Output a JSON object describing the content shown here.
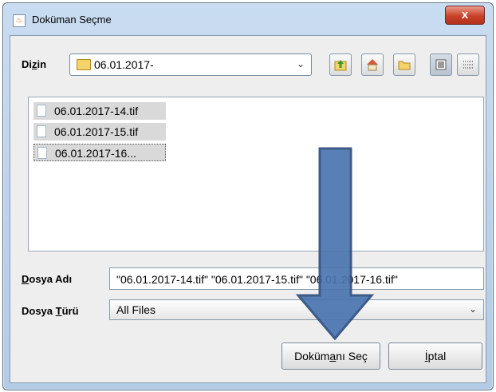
{
  "window": {
    "title": "Doküman Seçme",
    "close_glyph": "x"
  },
  "directory": {
    "label_pre": "Di",
    "label_mnemonic": "z",
    "label_post": "in",
    "value": "06.01.2017-"
  },
  "toolbar": {
    "icons": [
      "up-folder-icon",
      "home-icon",
      "new-folder-icon",
      "list-view-icon",
      "details-view-icon"
    ]
  },
  "files": [
    {
      "name": "06.01.2017-14.tif"
    },
    {
      "name": "06.01.2017-15.tif"
    },
    {
      "name": "06.01.2017-16..."
    }
  ],
  "filename": {
    "label_mnemonic": "D",
    "label_post": "osya Adı",
    "value": "\"06.01.2017-14.tif\" \"06.01.2017-15.tif\" \"06.01.2017-16.tif\""
  },
  "filetype": {
    "label_pre": "Dosya ",
    "label_mnemonic": "T",
    "label_post": "ürü",
    "value": "All Files"
  },
  "buttons": {
    "select_pre": "Doküm",
    "select_mnemonic": "a",
    "select_post": "nı Seç",
    "cancel_mnemonic": "İ",
    "cancel_post": "ptal"
  },
  "colors": {
    "titlebar": "#c9dcf1",
    "close": "#c8412a",
    "arrow_fill": "#4a75b0",
    "arrow_stroke": "#2f4f7e"
  }
}
